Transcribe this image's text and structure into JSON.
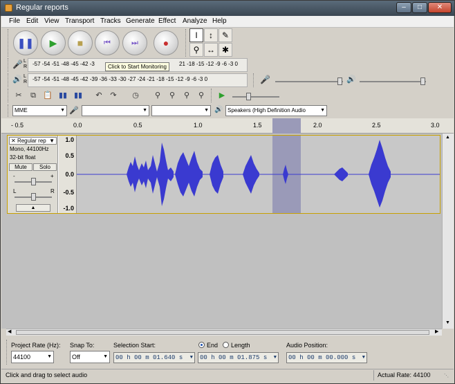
{
  "window": {
    "title": "Regular reports"
  },
  "menu": [
    "File",
    "Edit",
    "View",
    "Transport",
    "Tracks",
    "Generate",
    "Effect",
    "Analyze",
    "Help"
  ],
  "transport": {
    "pause_icon": "pause-icon",
    "play_icon": "play-icon",
    "stop_icon": "stop-icon",
    "skip_start_icon": "skip-start-icon",
    "skip_end_icon": "skip-end-icon",
    "record_icon": "record-icon"
  },
  "meters": {
    "record_ticks": "-57 -54 -51 -48 -45 -42 -3",
    "record_ticks_right": "21 -18 -15 -12 -9 -6 -3 0",
    "play_ticks": "-57 -54 -51 -48 -45 -42 -39 -36 -33 -30 -27 -24 -21 -18 -15 -12 -9 -6 -3 0",
    "tooltip": "Click to Start Monitoring"
  },
  "devices": {
    "host": "MME",
    "output": "Speakers (High Definition Audio"
  },
  "timeline": {
    "labels": [
      "- 0.5",
      "0.0",
      "0.5",
      "1.0",
      "1.5",
      "2.0",
      "2.5",
      "3.0"
    ]
  },
  "track": {
    "name": "Regular rep",
    "format": "Mono, 44100Hz",
    "depth": "32-bit float",
    "mute": "Mute",
    "solo": "Solo",
    "gain_min": "-",
    "gain_max": "+",
    "pan_left": "L",
    "pan_right": "R",
    "scale": [
      "1.0",
      "0.5",
      "0.0",
      "-0.5",
      "-1.0"
    ]
  },
  "selection_bar": {
    "project_rate_label": "Project Rate (Hz):",
    "project_rate": "44100",
    "snap_label": "Snap To:",
    "snap_value": "Off",
    "sel_start_label": "Selection Start:",
    "end_label": "End",
    "length_label": "Length",
    "audio_pos_label": "Audio Position:",
    "sel_start": "00 h 00 m 01.640 s",
    "sel_end": "00 h 00 m 01.875 s",
    "audio_pos": "00 h 00 m 00.000 s"
  },
  "status": {
    "left": "Click and drag to select audio",
    "right": "Actual Rate: 44100"
  }
}
